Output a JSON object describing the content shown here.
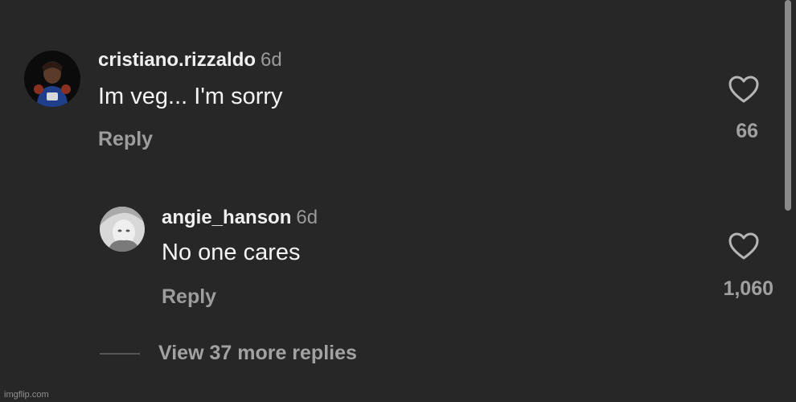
{
  "comments": [
    {
      "username": "cristiano.rizzaldo",
      "time": "6d",
      "text": "Im veg... I'm sorry",
      "reply_label": "Reply",
      "likes": "66"
    },
    {
      "username": "angie_hanson",
      "time": "6d",
      "text": "No one cares",
      "reply_label": "Reply",
      "likes": "1,060"
    }
  ],
  "view_more": "View 37 more replies",
  "watermark": "imgflip.com",
  "icons": {
    "like": "heart-icon"
  },
  "colors": {
    "background": "#272727",
    "text": "#f3f3f3",
    "secondary": "#9d9d9d"
  }
}
